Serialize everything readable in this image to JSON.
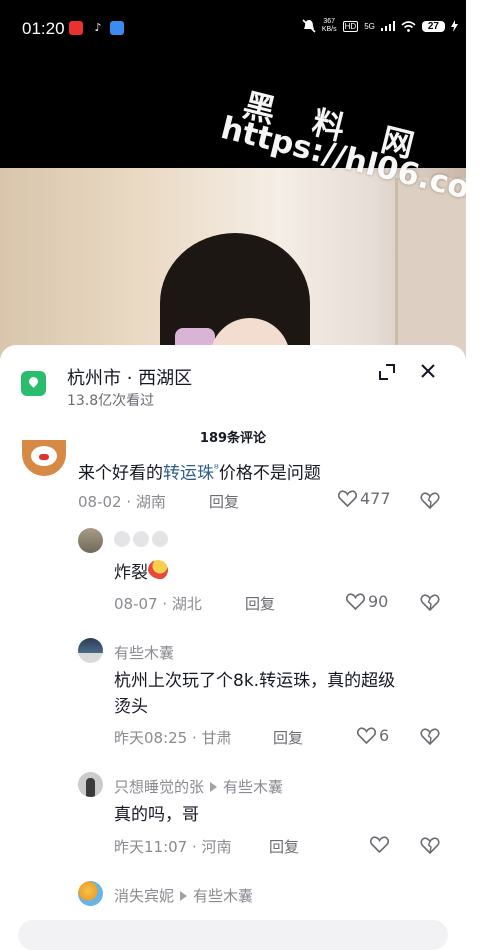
{
  "status_bar": {
    "time": "01:20",
    "net_speed_value": "367",
    "net_speed_unit": "KB/s",
    "hd_badge": "HD",
    "signal": "5G",
    "battery": "27"
  },
  "video": {
    "watermark_line1": "黑 料 网",
    "watermark_line2": "https://hl06.co"
  },
  "location": {
    "title": "杭州市 · 西湖区",
    "views": "13.8亿次看过"
  },
  "comments": {
    "count_title": "189条评论",
    "items": [
      {
        "text_before": "来个好看的",
        "link_text": "转运珠",
        "text_after": "价格不是问题",
        "date": "08-02",
        "region": "湖南",
        "reply": "回复",
        "likes": "477"
      },
      {
        "username": "",
        "text": "炸裂",
        "date": "08-07",
        "region": "湖北",
        "reply": "回复",
        "likes": "90"
      },
      {
        "username": "有些木囊",
        "text_line1": "杭州上次玩了个8k.转运珠，真的超级",
        "text_line2": "烫头",
        "date": "昨天08:25",
        "region": "甘肃",
        "reply": "回复",
        "likes": "6"
      },
      {
        "username": "只想睡觉的张",
        "reply_to": "有些木囊",
        "text": "真的吗，哥",
        "date": "昨天11:07",
        "region": "河南",
        "reply": "回复",
        "likes": ""
      },
      {
        "username": "消失宾妮",
        "reply_to": "有些木囊"
      }
    ]
  },
  "colors": {
    "link": "#2f5c8f",
    "location_icon": "#2bbd6e",
    "meta": "#8a8b91"
  }
}
